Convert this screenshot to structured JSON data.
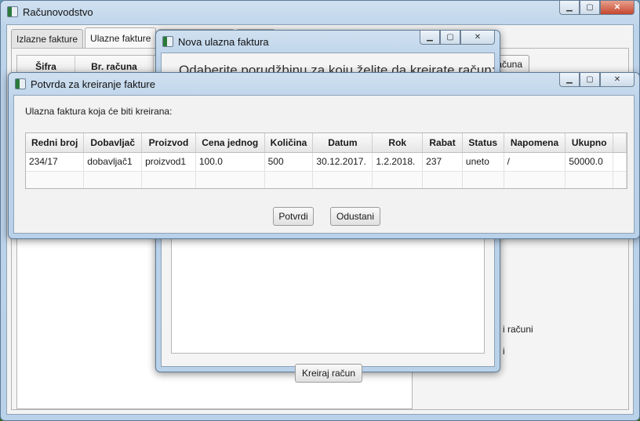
{
  "main": {
    "title": "Računovodstvo",
    "tabs": [
      {
        "label": "Izlazne fakture"
      },
      {
        "label": "Ulazne fakture"
      }
    ],
    "bg_table_headers": [
      "Šifra",
      "Br. računa"
    ],
    "bg_button_label": "računa",
    "bg_link_1": "i računi",
    "bg_link_2": "i"
  },
  "nova": {
    "title": "Nova ulazna faktura",
    "prompt": "Odaberite porudžbinu za koju želite da kreirate račun:",
    "create_button": "Kreiraj račun"
  },
  "potvrda": {
    "title": "Potvrda za kreiranje fakture",
    "label": "Ulazna faktura koja će biti kreirana:",
    "columns": [
      "Redni broj",
      "Dobavljač",
      "Proizvod",
      "Cena jednog",
      "Količina",
      "Datum",
      "Rok",
      "Rabat",
      "Status",
      "Napomena",
      "Ukupno"
    ],
    "row": [
      "234/17",
      "dobavljač1",
      "proizvod1",
      "100.0",
      "500",
      "30.12.2017.",
      "1.2.2018.",
      "237",
      "uneto",
      "/",
      "50000.0"
    ],
    "confirm_button": "Potvrdi",
    "cancel_button": "Odustani"
  },
  "icons": [
    "app-icon",
    "minimize-icon",
    "maximize-icon",
    "close-icon"
  ]
}
